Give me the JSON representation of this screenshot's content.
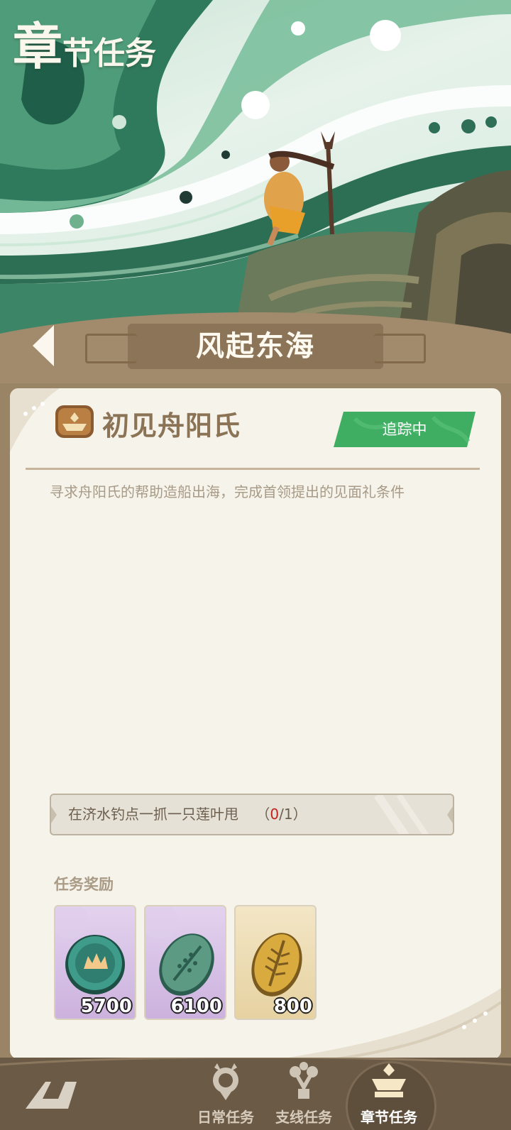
{
  "header": {
    "title_first_char": "章",
    "title_rest": "节任务"
  },
  "chapter": {
    "title": "风起东海",
    "back_icon": "back-arrow-icon"
  },
  "quest": {
    "icon": "boat-emblem-icon",
    "name": "初见舟阳氏",
    "status": "追踪中",
    "status_color": "#3fae62",
    "description": "寻求舟阳氏的帮助造船出海，完成首领提出的见面礼条件",
    "objective": {
      "text": "在济水钓点一抓一只莲叶甩",
      "progress_open": "（",
      "current": "0",
      "separator": "/",
      "total": "1",
      "progress_close": "）"
    }
  },
  "rewards": {
    "label": "任务奖励",
    "items": [
      {
        "icon": "jade-coin-icon",
        "count": "5700",
        "rarity": "purple"
      },
      {
        "icon": "jade-leaf-token-icon",
        "count": "6100",
        "rarity": "purple"
      },
      {
        "icon": "gold-leaf-token-icon",
        "count": "800",
        "rarity": "gold"
      }
    ]
  },
  "nav": {
    "items": [
      {
        "label": "日常任务",
        "icon": "bird-emblem-icon"
      },
      {
        "label": "支线任务",
        "icon": "branch-emblem-icon"
      },
      {
        "label": "章节任务",
        "icon": "boat-emblem-icon",
        "active": true
      }
    ]
  }
}
